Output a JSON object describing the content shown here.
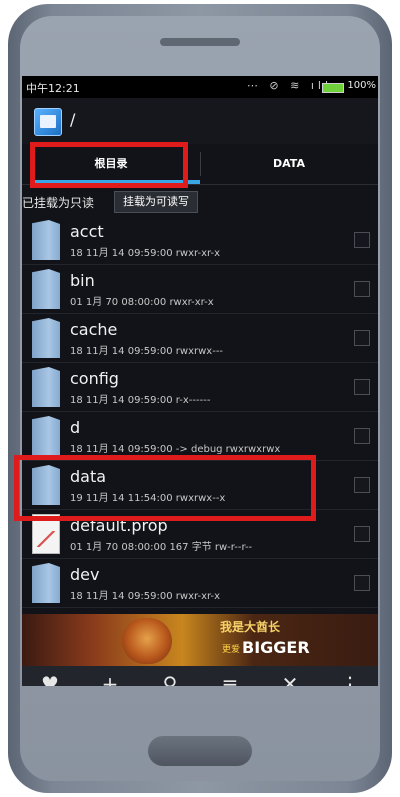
{
  "statusbar": {
    "time": "中午12:21",
    "battery": "100%",
    "icons": "⋯ ⊘ ≋ ıll"
  },
  "path": "/",
  "tabs": [
    {
      "label": "根目录"
    },
    {
      "label": "DATA"
    }
  ],
  "mount": {
    "label": "已挂载为只读",
    "button": "挂载为可读写"
  },
  "files": [
    {
      "name": "acct",
      "meta": "18 11月 14 09:59:00   rwxr-xr-x",
      "type": "folder"
    },
    {
      "name": "bin",
      "meta": "01 1月 70 08:00:00   rwxr-xr-x",
      "type": "folder"
    },
    {
      "name": "cache",
      "meta": "18 11月 14 09:59:00   rwxrwx---",
      "type": "folder"
    },
    {
      "name": "config",
      "meta": "18 11月 14 09:59:00   r-x------",
      "type": "folder"
    },
    {
      "name": "d",
      "meta": "18 11月 14 09:59:00   -> debug  rwxrwxrwx",
      "type": "folder"
    },
    {
      "name": "data",
      "meta": "19 11月 14 11:54:00   rwxrwx--x",
      "type": "folder"
    },
    {
      "name": "default.prop",
      "meta": "01 1月 70 08:00:00  167 字节   rw-r--r--",
      "type": "file"
    },
    {
      "name": "dev",
      "meta": "18 11月 14 09:59:00   rwxr-xr-x",
      "type": "folder"
    }
  ],
  "ad": {
    "title": "我是大酋长",
    "main": "BIGGER",
    "small": "更爱"
  },
  "toolbar": [
    {
      "icon": "heart-icon",
      "glyph": "♥"
    },
    {
      "icon": "plus-icon",
      "glyph": "+"
    },
    {
      "icon": "search-icon",
      "glyph": "⚲"
    },
    {
      "icon": "sort-icon",
      "glyph": "≡"
    },
    {
      "icon": "close-icon",
      "glyph": "✕"
    },
    {
      "icon": "more-icon",
      "glyph": "⋮"
    }
  ],
  "colors": {
    "highlight": "#e01b1b",
    "tab_accent": "#39a6e8"
  }
}
